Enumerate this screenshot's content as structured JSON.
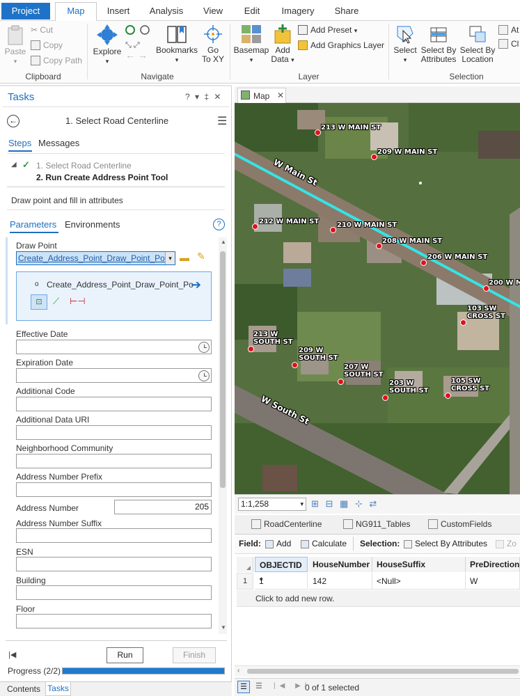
{
  "ribbon": {
    "tabs": [
      "Project",
      "Map",
      "Insert",
      "Analysis",
      "View",
      "Edit",
      "Imagery",
      "Share"
    ],
    "active_tab": "Map",
    "clipboard": {
      "paste": "Paste",
      "cut": "Cut",
      "copy": "Copy",
      "copy_path": "Copy Path",
      "group": "Clipboard"
    },
    "navigate": {
      "explore": "Explore",
      "bookmarks": "Bookmarks",
      "go_to_xy_line1": "Go",
      "go_to_xy_line2": "To XY",
      "group": "Navigate"
    },
    "layer": {
      "basemap": "Basemap",
      "add_data_line1": "Add",
      "add_data_line2": "Data",
      "add_preset": "Add Preset",
      "add_graphics_layer": "Add Graphics Layer",
      "group": "Layer"
    },
    "selection": {
      "select": "Select",
      "select_by_attributes_line1": "Select By",
      "select_by_attributes_line2": "Attributes",
      "select_by_location_line1": "Select By",
      "select_by_location_line2": "Location",
      "attributes_cut": "At",
      "clear_cut": "Cl",
      "group": "Selection"
    }
  },
  "tasks": {
    "title": "Tasks",
    "header_controls": "? ▾ ‡ ✕",
    "task_name": "1. Select Road Centerline",
    "subtabs": [
      "Steps",
      "Messages"
    ],
    "steps": [
      {
        "label": "1.  Select Road Centerline",
        "done": true
      },
      {
        "label": "2.  Run Create Address Point Tool",
        "done": false
      }
    ],
    "instruction": "Draw point and fill in attributes",
    "param_tabs": [
      "Parameters",
      "Environments"
    ],
    "draw_point": {
      "label": "Draw Point",
      "selected": "Create_Address_Point_Draw_Point_Point",
      "feature_name": "Create_Address_Point_Draw_Point_Po"
    },
    "fields": [
      {
        "label": "Effective Date",
        "value": "",
        "date": true
      },
      {
        "label": "Expiration Date",
        "value": "",
        "date": true
      },
      {
        "label": "Additional Code",
        "value": ""
      },
      {
        "label": "Additional Data URI",
        "value": ""
      },
      {
        "label": "Neighborhood Community",
        "value": ""
      },
      {
        "label": "Address Number Prefix",
        "value": ""
      },
      {
        "label": "Address Number",
        "value": "205",
        "inline": true
      },
      {
        "label": "Address Number Suffix",
        "value": ""
      },
      {
        "label": "ESN",
        "value": ""
      },
      {
        "label": "Building",
        "value": ""
      },
      {
        "label": "Floor",
        "value": ""
      }
    ],
    "run": "Run",
    "finish": "Finish",
    "progress_label": "Progress (2/2)",
    "progress": 1.0,
    "bottom_tabs": [
      "Contents",
      "Tasks"
    ]
  },
  "map": {
    "tab_title": "Map",
    "scale": "1:1,258",
    "address_labels": [
      {
        "text": "213 W MAIN ST"
      },
      {
        "text": "209 W MAIN ST"
      },
      {
        "text": "212 W MAIN ST"
      },
      {
        "text": "210 W MAIN ST"
      },
      {
        "text": "208 W MAIN ST"
      },
      {
        "text": "206 W MAIN ST"
      },
      {
        "text": "200 W M"
      },
      {
        "text": "103 SW\nCROSS ST"
      },
      {
        "text": "213 W\nSOUTH ST"
      },
      {
        "text": "209 W\nSOUTH ST"
      },
      {
        "text": "207 W\nSOUTH ST"
      },
      {
        "text": "203 W\nSOUTH ST"
      },
      {
        "text": "105 SW\nCROSS ST"
      }
    ],
    "street_labels": [
      "W Main St",
      "W South St"
    ]
  },
  "table": {
    "tabs": [
      "RoadCenterline",
      "NG911_Tables",
      "CustomFields"
    ],
    "toolbar": {
      "field": "Field:",
      "add": "Add",
      "calculate": "Calculate",
      "selection": "Selection:",
      "select_by_attributes": "Select By Attributes",
      "zoom": "Zo"
    },
    "columns": [
      "OBJECTID *",
      "HouseNumber",
      "HouseSuffix",
      "PreDirection"
    ],
    "rows": [
      {
        "num": "1",
        "cells": [
          "1",
          "142",
          "<Null>",
          "W"
        ]
      }
    ],
    "add_row": "Click to add new row.",
    "status": "0 of 1 selected"
  },
  "colors": {
    "accent": "#1e73c8",
    "road_highlight": "#36e3e6",
    "point": "#e0101c",
    "progress": "#1f7ad0"
  }
}
